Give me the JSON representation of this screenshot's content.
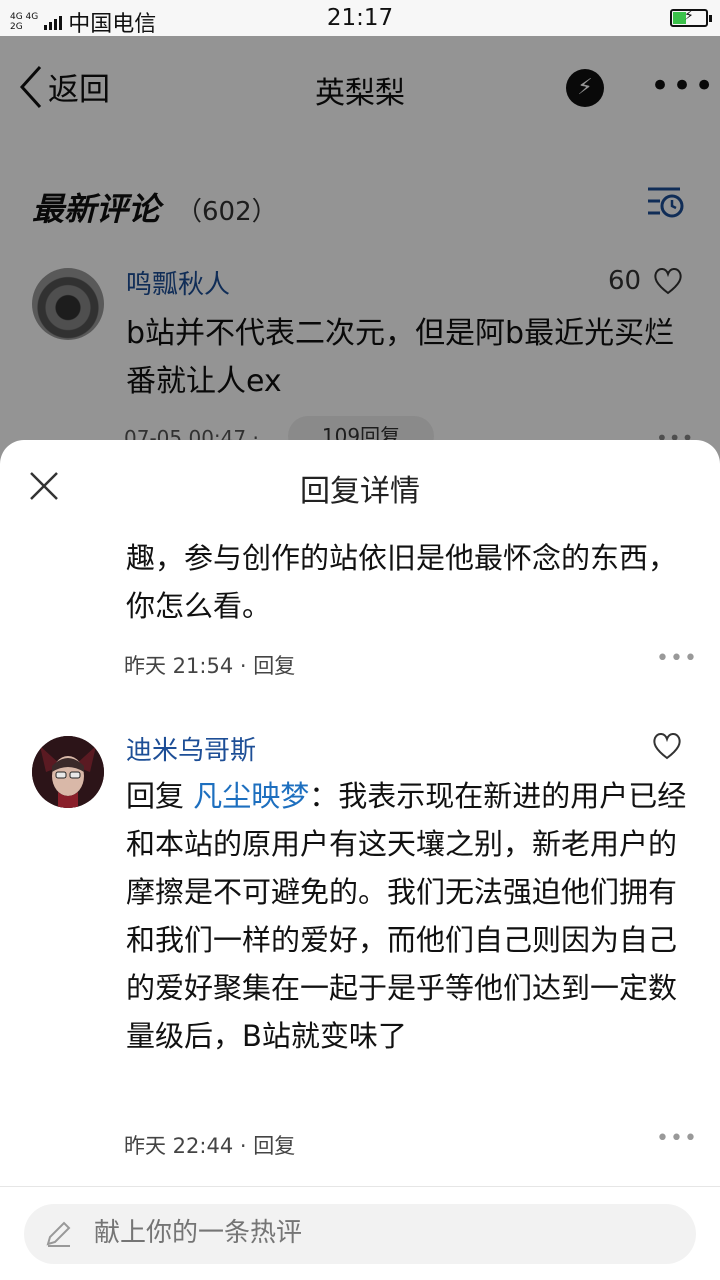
{
  "status_bar": {
    "net_top": "4G 4G",
    "net_bottom": "2G",
    "carrier": "中国电信",
    "time": "21:17"
  },
  "nav": {
    "back_label": "返回",
    "title": "英梨梨"
  },
  "comments_section": {
    "title": "最新评论",
    "count": "（602）"
  },
  "top_comment": {
    "user": "鸣瓢秋人",
    "likes": "60",
    "text": "b站并不代表二次元，但是阿b最近光买烂番就让人ex",
    "time": "07-05 00:47 ·",
    "replies": "109回复"
  },
  "sheet": {
    "title": "回复详情",
    "previous_reply": {
      "text": "趣，参与创作的站依旧是他最怀念的东西，你怎么看。",
      "time": "昨天 21:54",
      "reply_label": "回复"
    },
    "reply": {
      "user": "迪米乌哥斯",
      "prefix": "回复",
      "mention": "凡尘映梦",
      "text": "：我表示现在新进的用户已经和本站的原用户有这天壤之别，新老用户的摩擦是不可避免的。我们无法强迫他们拥有和我们一样的爱好，而他们自己则因为自己的爱好聚集在一起于是乎等他们达到一定数量级后，B站就变味了",
      "time": "昨天 22:44",
      "reply_label": "回复"
    },
    "input_placeholder": "献上你的一条热评"
  },
  "colors": {
    "username": "#1d4e96",
    "mention": "#1d6fbf",
    "overlay": "rgba(0,0,0,0.42)",
    "battery_fill": "#3bc14a"
  },
  "icons": [
    "back-chevron-icon",
    "bolt-icon",
    "more-icon",
    "sort-clock-icon",
    "heart-icon",
    "close-icon",
    "pencil-icon"
  ]
}
